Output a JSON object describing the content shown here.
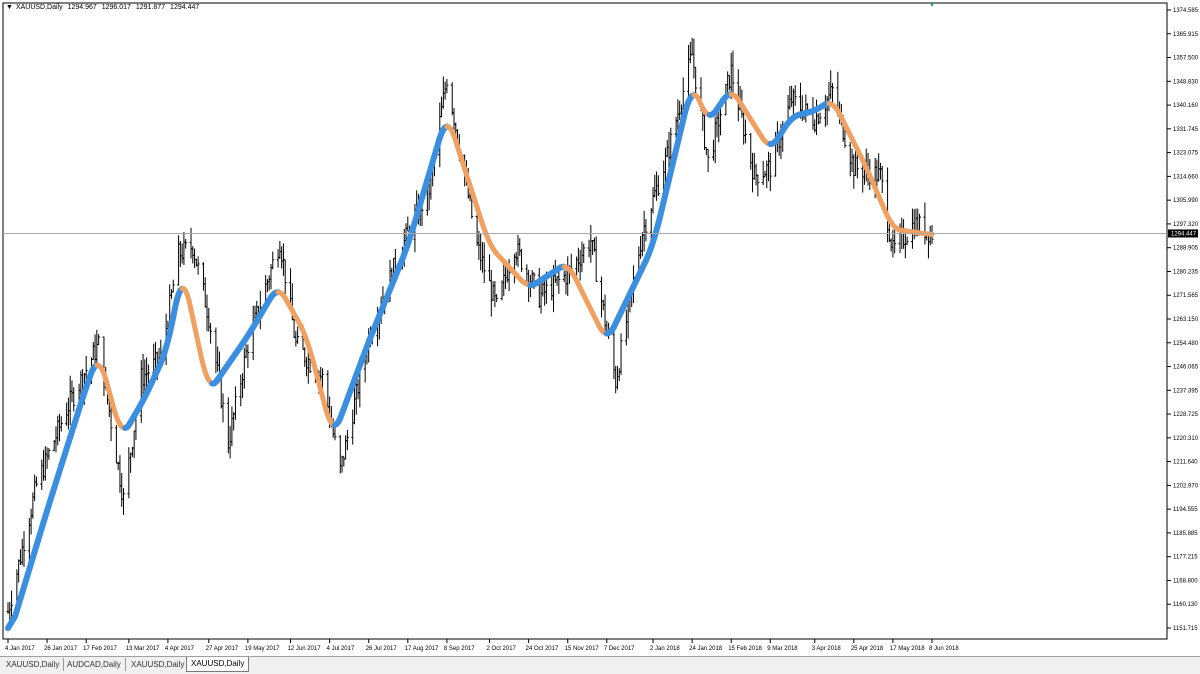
{
  "window": {
    "symbol_label": "XAUUSD,Daily",
    "ohlc": [
      "1294.967",
      "1296.017",
      "1291.877",
      "1294.447"
    ]
  },
  "current_price": "1294.447",
  "price_axis": {
    "labels": [
      "1374.585",
      "1365.915",
      "1357.500",
      "1348.830",
      "1340.160",
      "1331.745",
      "1323.075",
      "1314.660",
      "1305.990",
      "1297.320",
      "1288.905",
      "1280.235",
      "1271.565",
      "1263.150",
      "1254.480",
      "1246.065",
      "1237.395",
      "1228.725",
      "1220.310",
      "1211.640",
      "1202.970",
      "1194.555",
      "1185.885",
      "1177.215",
      "1168.800",
      "1160.130",
      "1151.715"
    ]
  },
  "time_axis": {
    "labels": [
      "4 Jan 2017",
      "26 Jan 2017",
      "17 Feb 2017",
      "13 Mar 2017",
      "4 Apr 2017",
      "27 Apr 2017",
      "19 May 2017",
      "12 Jun 2017",
      "4 Jul 2017",
      "26 Jul 2017",
      "17 Aug 2017",
      "8 Sep 2017",
      "2 Oct 2017",
      "24 Oct 2017",
      "15 Nov 2017",
      "7 Dec 2017",
      "2 Jan 2018",
      "24 Jan 2018",
      "15 Feb 2018",
      "9 Mar 2018",
      "3 Apr 2018",
      "25 Apr 2018",
      "17 May 2018",
      "8 Jun 2018"
    ]
  },
  "tabs": [
    {
      "label": "XAUUSD,Daily",
      "active": false
    },
    {
      "label": "AUDCAD,Daily",
      "active": false
    },
    {
      "label": "XAUUSD,Daily",
      "active": false
    },
    {
      "label": "XAUUSD,Daily",
      "active": true
    }
  ],
  "colors": {
    "bars": "#000000",
    "ma_up": "#3a8fe0",
    "ma_down": "#f0a060",
    "ma_edge": "#7a5a3a",
    "price_line": "#a8a8a8"
  },
  "chart_data": {
    "type": "candlestick-with-moving-average",
    "symbol": "XAUUSD",
    "timeframe": "Daily",
    "ylim": [
      1151.715,
      1374.585
    ],
    "x_range": [
      "4 Jan 2017",
      "8 Jun 2018"
    ],
    "close_path": [
      {
        "date": "4 Jan 2017",
        "close": 1160
      },
      {
        "date": "20 Jan 2017",
        "close": 1205
      },
      {
        "date": "6 Feb 2017",
        "close": 1232
      },
      {
        "date": "24 Feb 2017",
        "close": 1255
      },
      {
        "date": "10 Mar 2017",
        "close": 1200
      },
      {
        "date": "20 Mar 2017",
        "close": 1243
      },
      {
        "date": "31 Mar 2017",
        "close": 1250
      },
      {
        "date": "10 Apr 2017",
        "close": 1287
      },
      {
        "date": "18 Apr 2017",
        "close": 1290
      },
      {
        "date": "27 Apr 2017",
        "close": 1265
      },
      {
        "date": "8 May 2017",
        "close": 1220
      },
      {
        "date": "19 May 2017",
        "close": 1255
      },
      {
        "date": "6 Jun 2017",
        "close": 1292
      },
      {
        "date": "15 Jun 2017",
        "close": 1255
      },
      {
        "date": "30 Jun 2017",
        "close": 1243
      },
      {
        "date": "10 Jul 2017",
        "close": 1210
      },
      {
        "date": "26 Jul 2017",
        "close": 1258
      },
      {
        "date": "14 Aug 2017",
        "close": 1290
      },
      {
        "date": "29 Aug 2017",
        "close": 1310
      },
      {
        "date": "8 Sep 2017",
        "close": 1350
      },
      {
        "date": "25 Sep 2017",
        "close": 1290
      },
      {
        "date": "6 Oct 2017",
        "close": 1268
      },
      {
        "date": "16 Oct 2017",
        "close": 1290
      },
      {
        "date": "30 Oct 2017",
        "close": 1272
      },
      {
        "date": "15 Nov 2017",
        "close": 1280
      },
      {
        "date": "28 Nov 2017",
        "close": 1292
      },
      {
        "date": "12 Dec 2017",
        "close": 1242
      },
      {
        "date": "27 Dec 2017",
        "close": 1295
      },
      {
        "date": "10 Jan 2018",
        "close": 1322
      },
      {
        "date": "24 Jan 2018",
        "close": 1358
      },
      {
        "date": "2 Feb 2018",
        "close": 1320
      },
      {
        "date": "15 Feb 2018",
        "close": 1352
      },
      {
        "date": "28 Feb 2018",
        "close": 1315
      },
      {
        "date": "9 Mar 2018",
        "close": 1318
      },
      {
        "date": "21 Mar 2018",
        "close": 1342
      },
      {
        "date": "3 Apr 2018",
        "close": 1335
      },
      {
        "date": "13 Apr 2018",
        "close": 1345
      },
      {
        "date": "25 Apr 2018",
        "close": 1318
      },
      {
        "date": "10 May 2018",
        "close": 1315
      },
      {
        "date": "17 May 2018",
        "close": 1288
      },
      {
        "date": "29 May 2018",
        "close": 1298
      },
      {
        "date": "8 Jun 2018",
        "close": 1294.447
      }
    ],
    "moving_average": [
      {
        "date": "4 Jan 2017",
        "value": 1150
      },
      {
        "date": "26 Jan 2017",
        "value": 1196
      },
      {
        "date": "17 Feb 2017",
        "value": 1240
      },
      {
        "date": "24 Feb 2017",
        "value": 1252
      },
      {
        "date": "9 Mar 2017",
        "value": 1222
      },
      {
        "date": "22 Mar 2017",
        "value": 1236
      },
      {
        "date": "4 Apr 2017",
        "value": 1254
      },
      {
        "date": "12 Apr 2017",
        "value": 1282
      },
      {
        "date": "27 Apr 2017",
        "value": 1238
      },
      {
        "date": "19 May 2017",
        "value": 1258
      },
      {
        "date": "5 Jun 2017",
        "value": 1276
      },
      {
        "date": "21 Jun 2017",
        "value": 1258
      },
      {
        "date": "6 Jul 2017",
        "value": 1222
      },
      {
        "date": "26 Jul 2017",
        "value": 1256
      },
      {
        "date": "17 Aug 2017",
        "value": 1290
      },
      {
        "date": "8 Sep 2017",
        "value": 1337
      },
      {
        "date": "2 Oct 2017",
        "value": 1290
      },
      {
        "date": "24 Oct 2017",
        "value": 1275
      },
      {
        "date": "15 Nov 2017",
        "value": 1284
      },
      {
        "date": "7 Dec 2017",
        "value": 1256
      },
      {
        "date": "2 Jan 2018",
        "value": 1290
      },
      {
        "date": "24 Jan 2018",
        "value": 1348
      },
      {
        "date": "2 Feb 2018",
        "value": 1334
      },
      {
        "date": "15 Feb 2018",
        "value": 1346
      },
      {
        "date": "9 Mar 2018",
        "value": 1324
      },
      {
        "date": "21 Mar 2018",
        "value": 1336
      },
      {
        "date": "3 Apr 2018",
        "value": 1338
      },
      {
        "date": "13 Apr 2018",
        "value": 1342
      },
      {
        "date": "2 May 2018",
        "value": 1318
      },
      {
        "date": "17 May 2018",
        "value": 1296
      },
      {
        "date": "8 Jun 2018",
        "value": 1294
      }
    ]
  }
}
